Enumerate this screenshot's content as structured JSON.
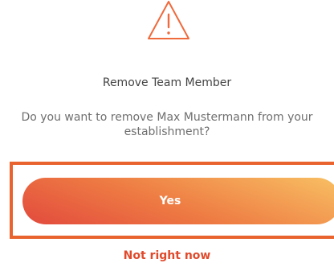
{
  "dialog": {
    "icon": "warning-triangle-icon",
    "title": "Remove Team Member",
    "message": "Do you want to remove Max Mustermann from your establishment?",
    "confirm_label": "Yes",
    "cancel_label": "Not right now"
  },
  "colors": {
    "accent": "#e8632e",
    "icon_stroke": "#ef6a3c",
    "button_gradient_start": "#e24a3d",
    "button_gradient_end": "#f8c063",
    "link": "#e04a2c"
  }
}
